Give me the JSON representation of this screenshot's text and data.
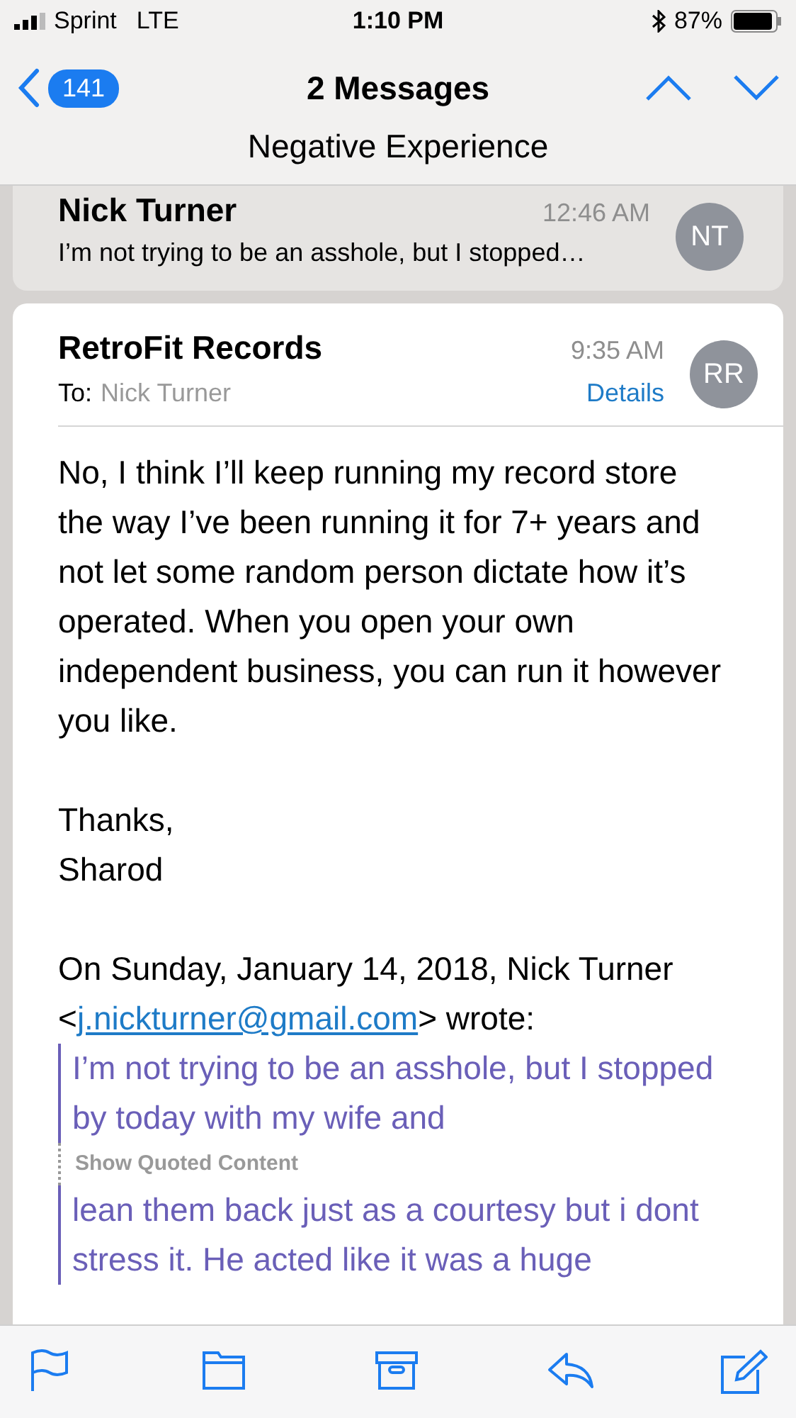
{
  "status_bar": {
    "carrier": "Sprint",
    "network": "LTE",
    "time": "1:10 PM",
    "battery": "87%"
  },
  "nav": {
    "back_count": "141",
    "title": "2 Messages",
    "subject": "Negative Experience"
  },
  "messages": [
    {
      "kind": "collapsed",
      "sender": "Nick Turner",
      "time": "12:46 AM",
      "preview": "I’m not trying to be an asshole, but I stopped…",
      "initials": "NT"
    },
    {
      "kind": "expanded",
      "sender": "RetroFit Records",
      "time": "9:35 AM",
      "to_label": "To:",
      "to": "Nick Turner",
      "details": "Details",
      "initials": "RR",
      "body": [
        "No, I think I’ll keep running my record store the way I’ve been running it for 7+ years and not let some random person dictate how it’s operated. When you open your own independent business, you can run it however you like.",
        "Thanks,\nSharod"
      ],
      "attribution": {
        "before": "On Sunday, January 14, 2018, Nick Turner <",
        "email": "j.nickturner@gmail.com",
        "after": "> wrote:"
      },
      "quotes": [
        "I’m not trying to be an asshole, but I stopped by today with my wife and",
        "lean them back just as a courtesy but i dont stress it. He acted like it was a huge"
      ],
      "show_quoted": "Show Quoted Content"
    }
  ],
  "toolbar": [
    {
      "kind": "flag"
    },
    {
      "kind": "folder"
    },
    {
      "kind": "archive"
    },
    {
      "kind": "reply"
    },
    {
      "kind": "compose"
    }
  ]
}
